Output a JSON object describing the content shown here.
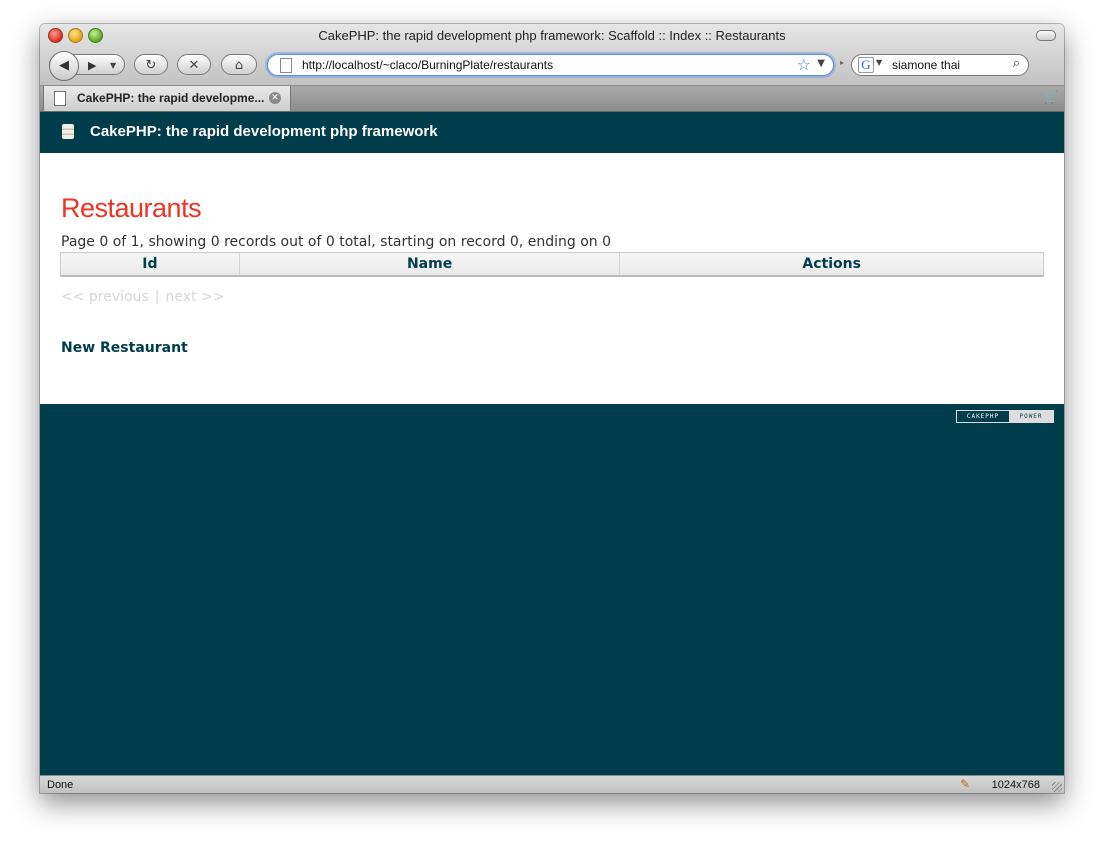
{
  "window": {
    "title": "CakePHP: the rapid development php framework: Scaffold :: Index :: Restaurants"
  },
  "toolbar": {
    "url": "http://localhost/~claco/BurningPlate/restaurants",
    "search_value": "siamone thai",
    "search_engine_letter": "G"
  },
  "tabs": [
    {
      "label": "CakePHP: the rapid developme..."
    }
  ],
  "header": {
    "title": "CakePHP: the rapid development php framework"
  },
  "main": {
    "heading": "Restaurants",
    "paging_info": "Page 0 of 1, showing 0 records out of 0 total, starting on record 0, ending on 0",
    "table": {
      "columns": [
        "Id",
        "Name",
        "Actions"
      ],
      "rows": []
    },
    "paging": {
      "previous": "<< previous",
      "separator": "|",
      "next": "next >>"
    },
    "new_link": "New Restaurant"
  },
  "footer": {
    "powered_left": "CAKEPHP",
    "powered_right": "POWER"
  },
  "statusbar": {
    "text": "Done",
    "resolution": "1024x768"
  },
  "colors": {
    "cake_dark_teal": "#003d4c",
    "heading_red": "#ee3322",
    "disabled_gray": "#d6d6d6"
  }
}
